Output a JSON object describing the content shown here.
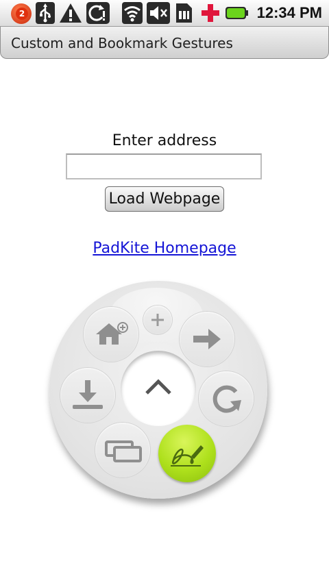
{
  "status_bar": {
    "notification_count": "2",
    "time": "12:34 PM",
    "icons": [
      "notification-badge-icon",
      "usb-icon",
      "warning-icon",
      "sync-alert-icon",
      "wifi-icon",
      "mute-icon",
      "sim-card-icon",
      "medical-cross-icon",
      "battery-icon"
    ]
  },
  "titlebar": {
    "title": "Custom and Bookmark Gestures"
  },
  "form": {
    "address_label": "Enter address",
    "address_value": "",
    "load_button": "Load Webpage"
  },
  "link": {
    "text": "PadKite Homepage"
  },
  "radial_menu": {
    "items": [
      "add-icon",
      "add-home-icon",
      "forward-arrow-icon",
      "download-icon",
      "reload-icon",
      "tabs-icon",
      "signature-icon",
      "up-chevron-icon"
    ],
    "accent": "#aee01c"
  }
}
